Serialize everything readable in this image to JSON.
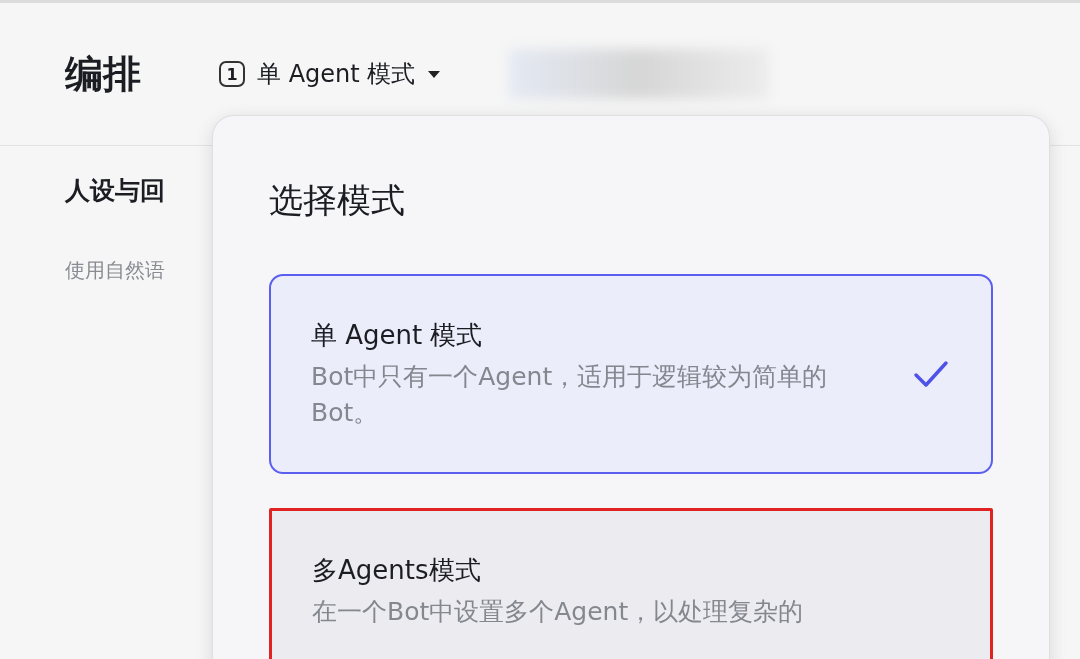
{
  "header": {
    "title": "编排",
    "mode_button": {
      "icon": "1",
      "label": "单 Agent 模式"
    }
  },
  "panel": {
    "title": "人设与回",
    "hint": "使用自然语"
  },
  "popover": {
    "title": "选择模式",
    "options": [
      {
        "title": "单 Agent 模式",
        "description": "Bot中只有一个Agent，适用于逻辑较为简单的Bot。",
        "selected": true,
        "highlighted": false
      },
      {
        "title": "多Agents模式",
        "description": "在一个Bot中设置多个Agent，以处理复杂的",
        "selected": false,
        "highlighted": true
      }
    ]
  }
}
